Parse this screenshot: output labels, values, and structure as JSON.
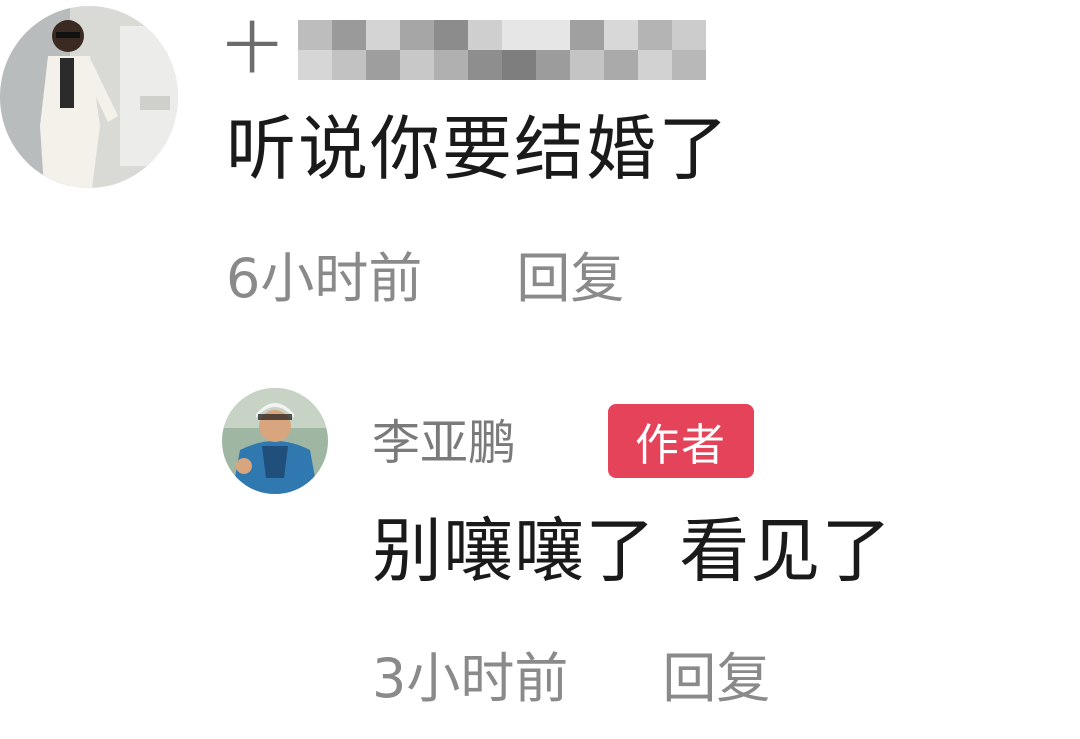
{
  "colors": {
    "background": "#ffffff",
    "username": "#7a7a7a",
    "comment_text": "#1a1a1a",
    "meta_text": "#8a8a8a",
    "author_badge": "#e5435a"
  },
  "comments": [
    {
      "username_visible_prefix": "十",
      "username_obscured": true,
      "text": "听说你要结婚了",
      "time": "6小时前",
      "reply_label": "回复",
      "replies": [
        {
          "username": "李亚鹏",
          "badge": "作者",
          "text": "别嚷嚷了 看见了",
          "time": "3小时前",
          "reply_label": "回复"
        }
      ]
    }
  ]
}
